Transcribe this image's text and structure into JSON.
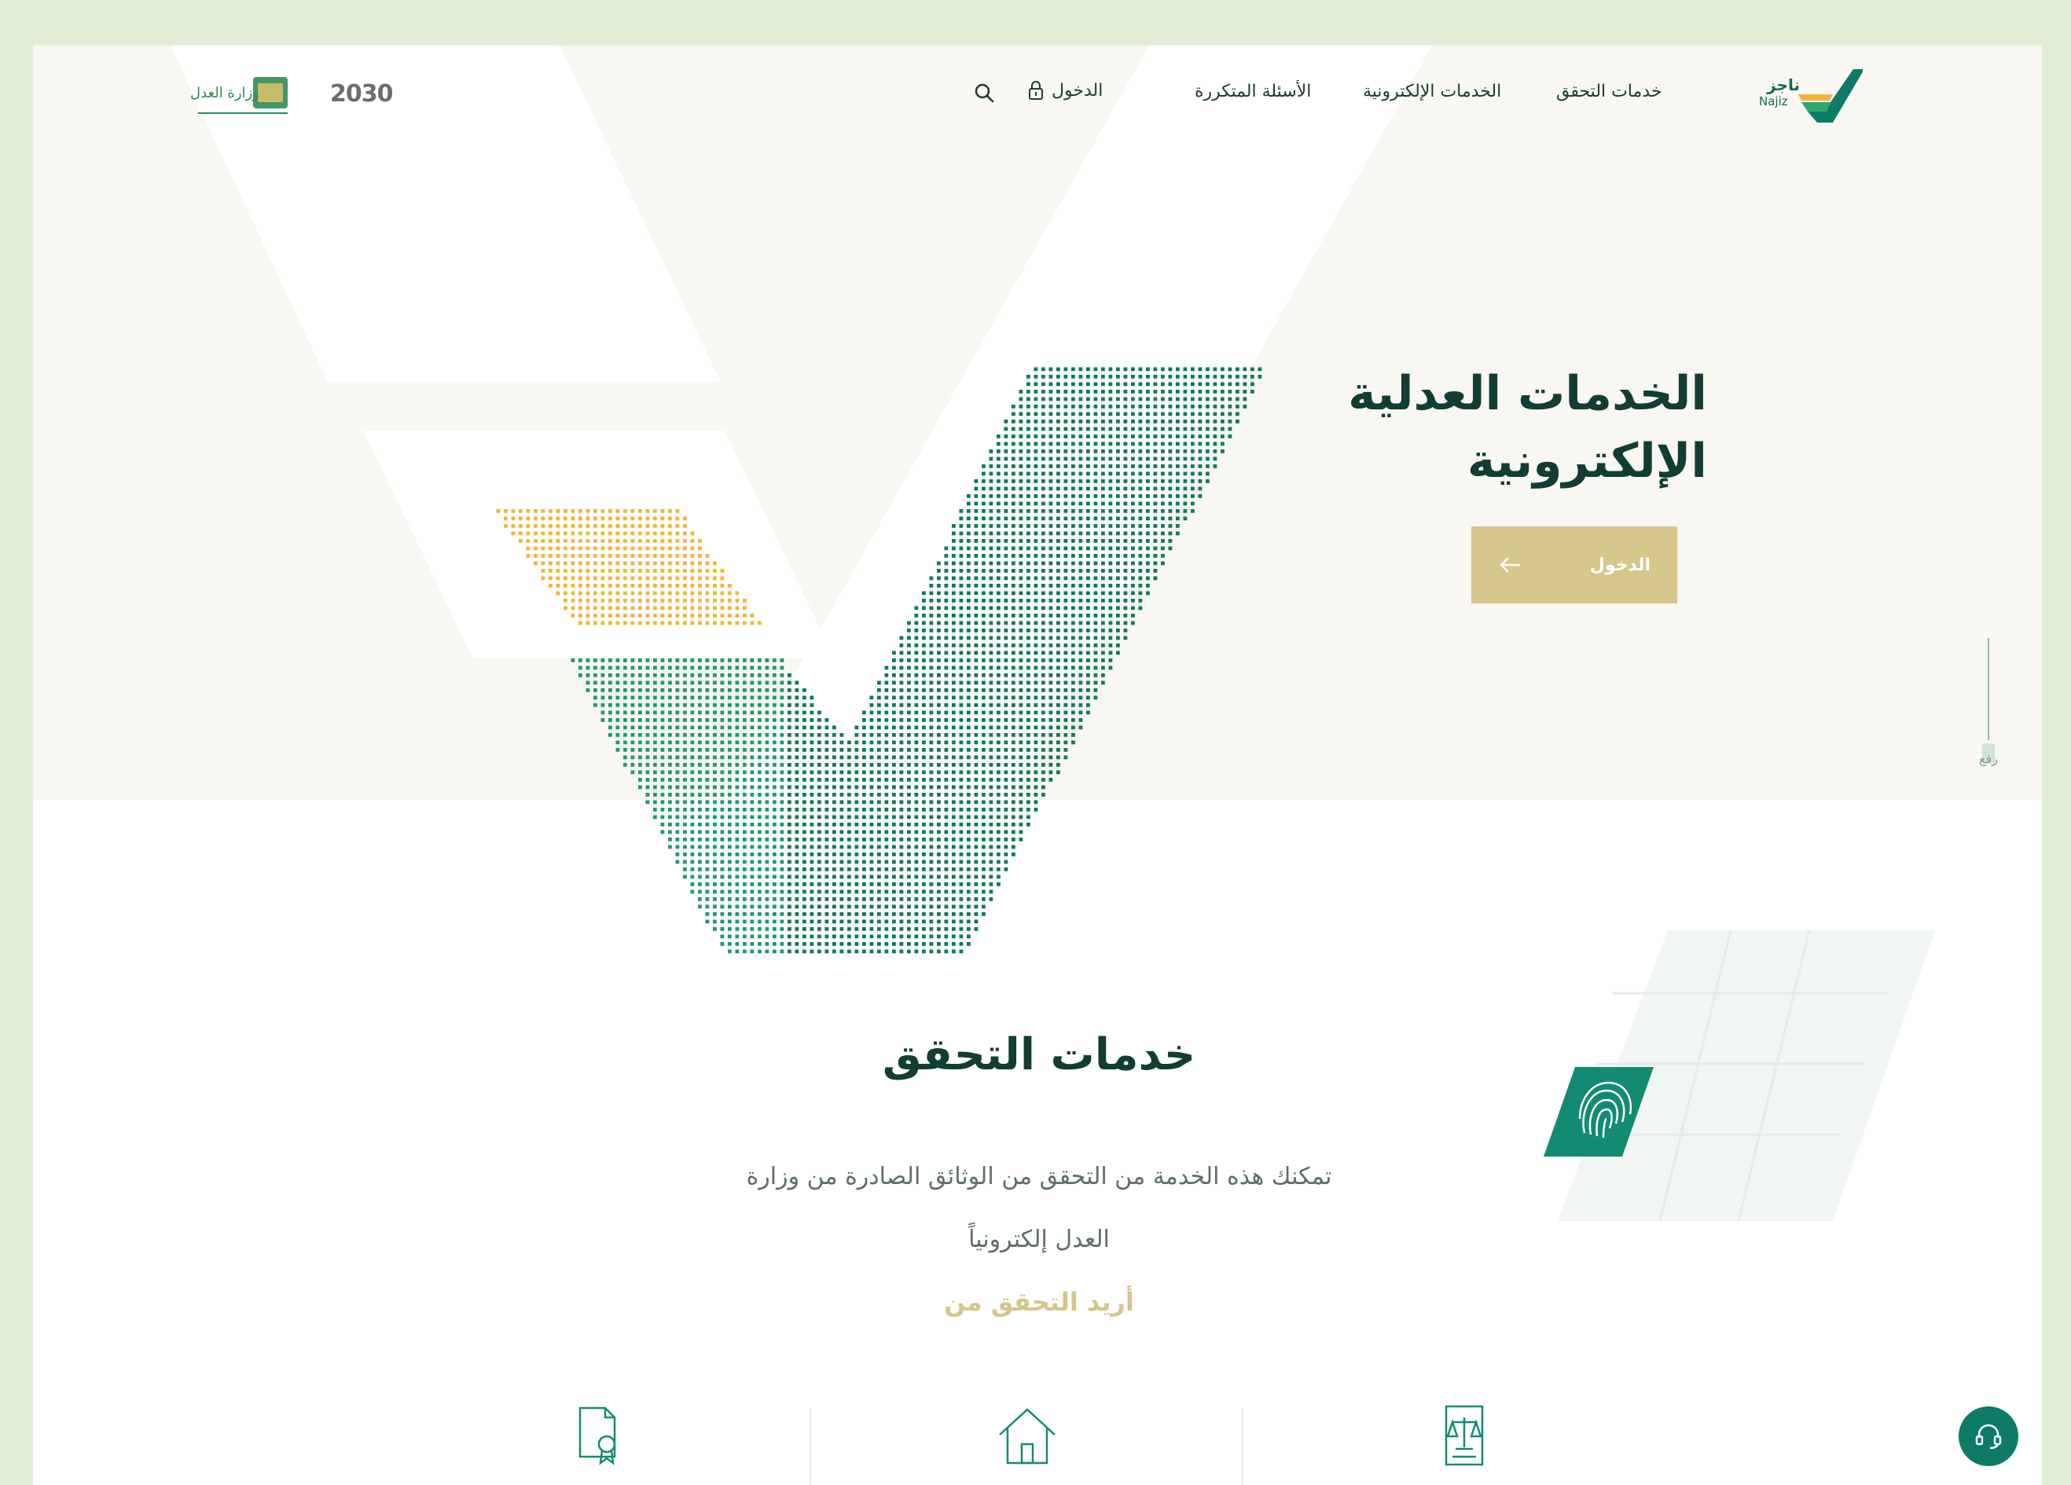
{
  "header": {
    "logo_text": "ناجز",
    "logo_sub": "Najiz",
    "nav": {
      "verification": "خدمات التحقق",
      "eservices": "الخدمات الإلكترونية",
      "faq": "الأسئلة المتكررة",
      "login": "الدخول"
    },
    "vision_logo": "2030",
    "ministry_logo": "وزارة العدل"
  },
  "hero": {
    "title_line1": "الخدمات العدلية",
    "title_line2": "الإلكترونية",
    "button_label": "الدخول",
    "scroll_label": "رفع"
  },
  "verification": {
    "title": "خدمات التحقق",
    "description_line1": "تمكنك هذه الخدمة من التحقق من الوثائق الصادرة من وزارة",
    "description_line2": "العدل إلكترونياً",
    "link": "أريد التحقق من"
  },
  "colors": {
    "primary": "#123d33",
    "accent_gold": "#d5c68b",
    "dots_green": "#0e7a5c",
    "dots_gold": "#efb63b",
    "frame": "#e3eed6"
  },
  "icons": [
    "search-icon",
    "lock-icon",
    "arrow-left-icon",
    "fingerprint-icon",
    "certificate-icon",
    "house-icon",
    "scales-document-icon",
    "chat-icon"
  ]
}
